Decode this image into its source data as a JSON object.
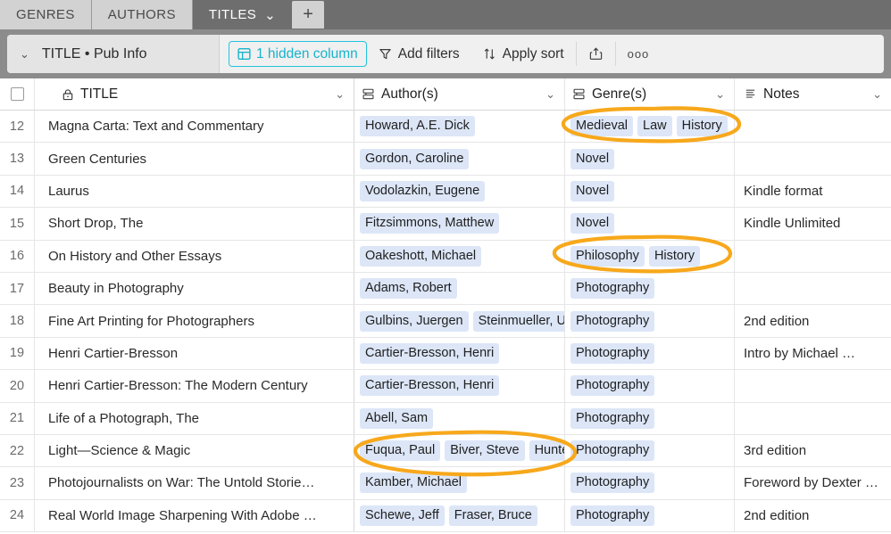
{
  "tabs": [
    {
      "label": "GENRES",
      "active": false
    },
    {
      "label": "AUTHORS",
      "active": false
    },
    {
      "label": "TITLES",
      "active": true
    }
  ],
  "tab_add_label": "+",
  "tab_chevron": "⌄",
  "toolbar": {
    "view_name": "TITLE • Pub Info",
    "view_chevron": "⌄",
    "hidden_column_label": "1 hidden column",
    "hidden_column_color": "#17b4cd",
    "add_filters_label": "Add filters",
    "apply_sort_label": "Apply sort",
    "share_icon": "share-icon",
    "more_label": "ooo"
  },
  "columns": [
    {
      "key": "title",
      "label": "TITLE",
      "icon": "lock-icon"
    },
    {
      "key": "author",
      "label": "Author(s)",
      "icon": "linked-record-icon"
    },
    {
      "key": "genre",
      "label": "Genre(s)",
      "icon": "linked-record-icon"
    },
    {
      "key": "notes",
      "label": "Notes",
      "icon": "long-text-icon"
    }
  ],
  "header_chevron": "⌄",
  "rows": [
    {
      "num": "12",
      "title": "Magna Carta: Text and Commentary",
      "authors": [
        "Howard, A.E. Dick"
      ],
      "genres": [
        "Medieval",
        "Law",
        "History"
      ],
      "notes": ""
    },
    {
      "num": "13",
      "title": "Green Centuries",
      "authors": [
        "Gordon, Caroline"
      ],
      "genres": [
        "Novel"
      ],
      "notes": ""
    },
    {
      "num": "14",
      "title": "Laurus",
      "authors": [
        "Vodolazkin, Eugene"
      ],
      "genres": [
        "Novel"
      ],
      "notes": "Kindle format"
    },
    {
      "num": "15",
      "title": "Short Drop, The",
      "authors": [
        "Fitzsimmons, Matthew"
      ],
      "genres": [
        "Novel"
      ],
      "notes": "Kindle Unlimited"
    },
    {
      "num": "16",
      "title": "On History and Other Essays",
      "authors": [
        "Oakeshott, Michael"
      ],
      "genres": [
        "Philosophy",
        "History"
      ],
      "notes": ""
    },
    {
      "num": "17",
      "title": "Beauty in Photography",
      "authors": [
        "Adams, Robert"
      ],
      "genres": [
        "Photography"
      ],
      "notes": ""
    },
    {
      "num": "18",
      "title": "Fine Art Printing for Photographers",
      "authors": [
        "Gulbins, Juergen",
        "Steinmueller, U"
      ],
      "genres": [
        "Photography"
      ],
      "notes": "2nd edition"
    },
    {
      "num": "19",
      "title": "Henri Cartier-Bresson",
      "authors": [
        "Cartier-Bresson, Henri"
      ],
      "genres": [
        "Photography"
      ],
      "notes": "Intro by Michael …"
    },
    {
      "num": "20",
      "title": "Henri Cartier-Bresson: The Modern Century",
      "authors": [
        "Cartier-Bresson, Henri"
      ],
      "genres": [
        "Photography"
      ],
      "notes": ""
    },
    {
      "num": "21",
      "title": "Life of a Photograph, The",
      "authors": [
        "Abell, Sam"
      ],
      "genres": [
        "Photography"
      ],
      "notes": ""
    },
    {
      "num": "22",
      "title": "Light—Science & Magic",
      "authors": [
        "Fuqua, Paul",
        "Biver, Steve",
        "Hunte"
      ],
      "genres": [
        "Photography"
      ],
      "notes": "3rd edition"
    },
    {
      "num": "23",
      "title": "Photojournalists on War: The Untold Storie…",
      "authors": [
        "Kamber, Michael"
      ],
      "genres": [
        "Photography"
      ],
      "notes": "Foreword by Dexter …"
    },
    {
      "num": "24",
      "title": "Real World Image Sharpening With Adobe …",
      "authors": [
        "Schewe, Jeff",
        "Fraser, Bruce"
      ],
      "genres": [
        "Photography"
      ],
      "notes": "2nd edition"
    }
  ],
  "annotations": {
    "color": "#f7a81b",
    "marks": [
      {
        "name": "ellipse-genres-row12"
      },
      {
        "name": "ellipse-genres-row16"
      },
      {
        "name": "ellipse-authors-row22"
      }
    ]
  }
}
